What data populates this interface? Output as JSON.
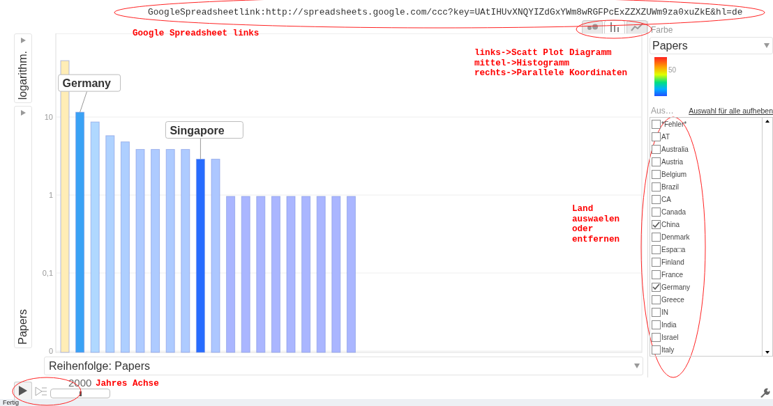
{
  "link_text": "GoogleSpreadsheetlink:http://spreadsheets.google.com/ccc?key=UAtIHUvXNQYIZdGxYWm8wRGFPcExZZXZUWm9za0xuZkE&hl=de",
  "chart_types": [
    {
      "kind": "scatter",
      "selected": false
    },
    {
      "kind": "bar",
      "selected": true
    },
    {
      "kind": "line",
      "selected": false
    }
  ],
  "axis_pickers": [
    {
      "label": "logarithm."
    },
    {
      "label": "Papers"
    }
  ],
  "chart": {
    "y_axis_labels": [
      "10",
      "1",
      "0,1",
      "0"
    ],
    "callouts": [
      {
        "text": "Germany"
      },
      {
        "text": "Singapore"
      }
    ]
  },
  "color_panel": {
    "label": "Farbe",
    "dropdown": "Papers",
    "legend_tick": "50"
  },
  "selection": {
    "label": "Aus…",
    "clear_link": "Auswahl für alle aufheben",
    "items": [
      {
        "label": "*Fehler*",
        "checked": false
      },
      {
        "label": "AT",
        "checked": false
      },
      {
        "label": "Australia",
        "checked": false
      },
      {
        "label": "Austria",
        "checked": false
      },
      {
        "label": "Belgium",
        "checked": false
      },
      {
        "label": "Brazil",
        "checked": false
      },
      {
        "label": "CA",
        "checked": false
      },
      {
        "label": "Canada",
        "checked": false
      },
      {
        "label": "China",
        "checked": true
      },
      {
        "label": "Denmark",
        "checked": false
      },
      {
        "label": "Espa□a",
        "checked": false
      },
      {
        "label": "Finland",
        "checked": false
      },
      {
        "label": "France",
        "checked": false
      },
      {
        "label": "Germany",
        "checked": true
      },
      {
        "label": "Greece",
        "checked": false
      },
      {
        "label": "IN",
        "checked": false
      },
      {
        "label": "India",
        "checked": false
      },
      {
        "label": "Israel",
        "checked": false
      },
      {
        "label": "Italy",
        "checked": false
      }
    ]
  },
  "order_dropdown": "Reihenfolge: Papers",
  "time_slider": {
    "year": "2000",
    "level": 0.5
  },
  "status": "Fertig",
  "annotations": [
    {
      "text": "Google Spreadsheet links"
    },
    {
      "text": "links->Scatt Plot Diagramm\nmittel->Histogramm\nrechts->Parallele Koordinaten"
    },
    {
      "text": "Land\nauswaelen\noder\nentfernen"
    },
    {
      "text": "Jahres Achse"
    }
  ]
}
